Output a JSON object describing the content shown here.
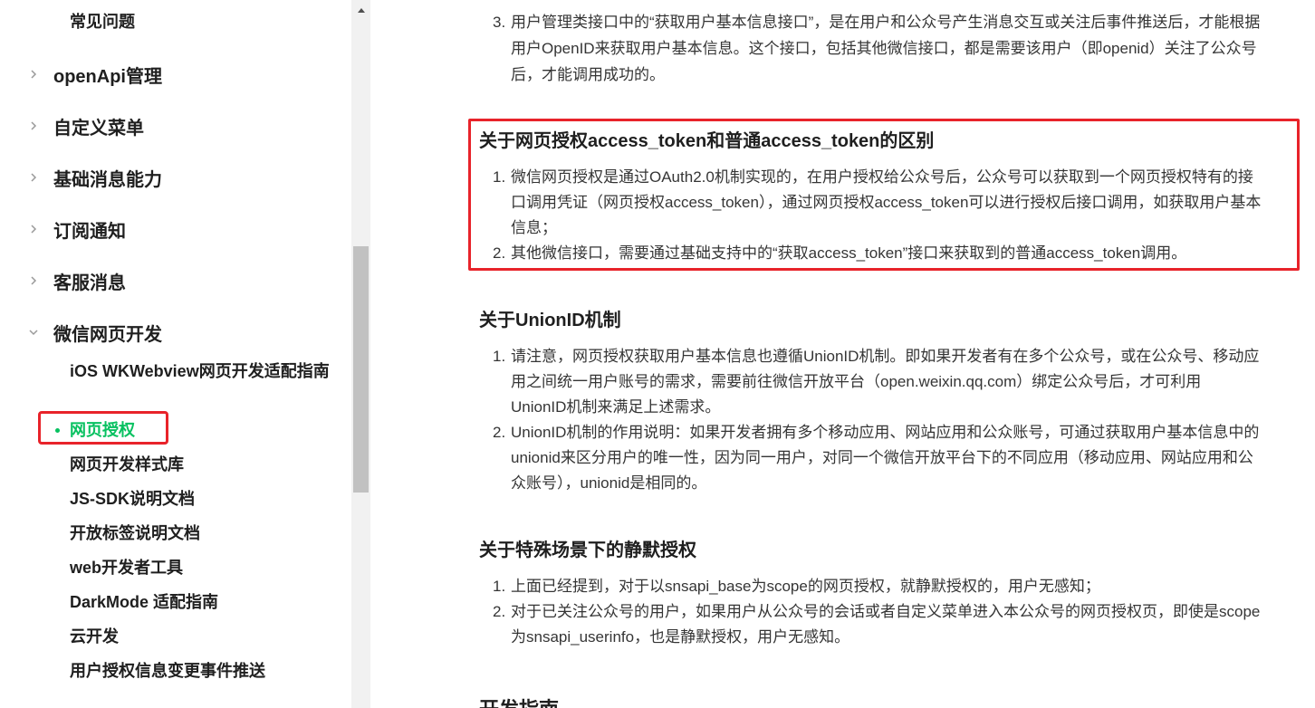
{
  "sidebar": {
    "top_partial_item": "常见问题",
    "groups": [
      {
        "label": "openApi管理",
        "expanded": false
      },
      {
        "label": "自定义菜单",
        "expanded": false
      },
      {
        "label": "基础消息能力",
        "expanded": false
      },
      {
        "label": "订阅通知",
        "expanded": false
      },
      {
        "label": "客服消息",
        "expanded": false
      },
      {
        "label": "微信网页开发",
        "expanded": true
      }
    ],
    "sub_items": [
      "iOS WKWebview网页开发适配指南",
      "网页授权",
      "网页开发样式库",
      "JS-SDK说明文档",
      "开放标签说明文档",
      "web开发者工具",
      "DarkMode 适配指南",
      "云开发",
      "用户授权信息变更事件推送"
    ],
    "active_item": "网页授权",
    "active_color": "#07c160",
    "highlight_color": "#e8232a"
  },
  "content": {
    "top_item": {
      "num": "3.",
      "lines": [
        "用户管理类接口中的“获取用户基本信息接口”，是在用户和公众号产生消息交互或关注后事件推送后，才能根据",
        "用户OpenID来获取用户基本信息。这个接口，包括其他微信接口，都是需要该用户（即openid）关注了公众号",
        "后，才能调用成功的。"
      ]
    },
    "section1": {
      "title": "关于网页授权access_token和普通access_token的区别",
      "items": [
        {
          "num": "1.",
          "lines": [
            "微信网页授权是通过OAuth2.0机制实现的，在用户授权给公众号后，公众号可以获取到一个网页授权特有的接",
            "口调用凭证（网页授权access_token），通过网页授权access_token可以进行授权后接口调用，如获取用户基本",
            "信息；"
          ]
        },
        {
          "num": "2.",
          "lines": [
            "其他微信接口，需要通过基础支持中的“获取access_token”接口来获取到的普通access_token调用。"
          ]
        }
      ]
    },
    "section2": {
      "title": "关于UnionID机制",
      "items": [
        {
          "num": "1.",
          "lines": [
            "请注意，网页授权获取用户基本信息也遵循UnionID机制。即如果开发者有在多个公众号，或在公众号、移动应",
            "用之间统一用户账号的需求，需要前往微信开放平台（open.weixin.qq.com）绑定公众号后，才可利用",
            "UnionID机制来满足上述需求。"
          ]
        },
        {
          "num": "2.",
          "lines": [
            "UnionID机制的作用说明：如果开发者拥有多个移动应用、网站应用和公众账号，可通过获取用户基本信息中的",
            "unionid来区分用户的唯一性，因为同一用户，对同一个微信开放平台下的不同应用（移动应用、网站应用和公",
            "众账号），unionid是相同的。"
          ]
        }
      ]
    },
    "section3": {
      "title": "关于特殊场景下的静默授权",
      "items": [
        {
          "num": "1.",
          "lines": [
            "上面已经提到，对于以snsapi_base为scope的网页授权，就静默授权的，用户无感知；"
          ]
        },
        {
          "num": "2.",
          "lines": [
            "对于已关注公众号的用户，如果用户从公众号的会话或者自定义菜单进入本公众号的网页授权页，即使是scope",
            "为snsapi_userinfo，也是静默授权，用户无感知。"
          ]
        }
      ]
    },
    "next_heading_partial": "开发指南"
  }
}
